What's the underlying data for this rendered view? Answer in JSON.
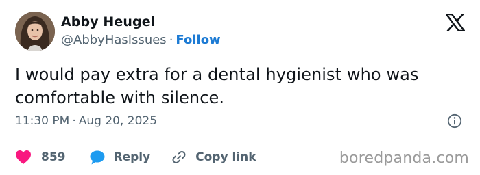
{
  "tweet": {
    "author": {
      "name": "Abby Heugel",
      "handle": "@AbbyHasIssues",
      "separator": "·",
      "follow_label": "Follow"
    },
    "text": "I would pay extra for a dental hygienist who was comfortable with silence.",
    "time": "11:30 PM",
    "time_separator": "·",
    "date": "Aug 20, 2025",
    "actions": {
      "like_count": "859",
      "reply_label": "Reply",
      "copy_link_label": "Copy link"
    }
  },
  "icons": {
    "logo": "x-logo-icon",
    "info": "info-icon",
    "like": "heart-icon",
    "reply": "speech-bubble-icon",
    "copy": "link-icon"
  },
  "colors": {
    "accent": "#1d7bd4",
    "like": "#f91880",
    "reply": "#1d9bf0",
    "muted": "#536471"
  },
  "watermark": "boredpanda.com"
}
